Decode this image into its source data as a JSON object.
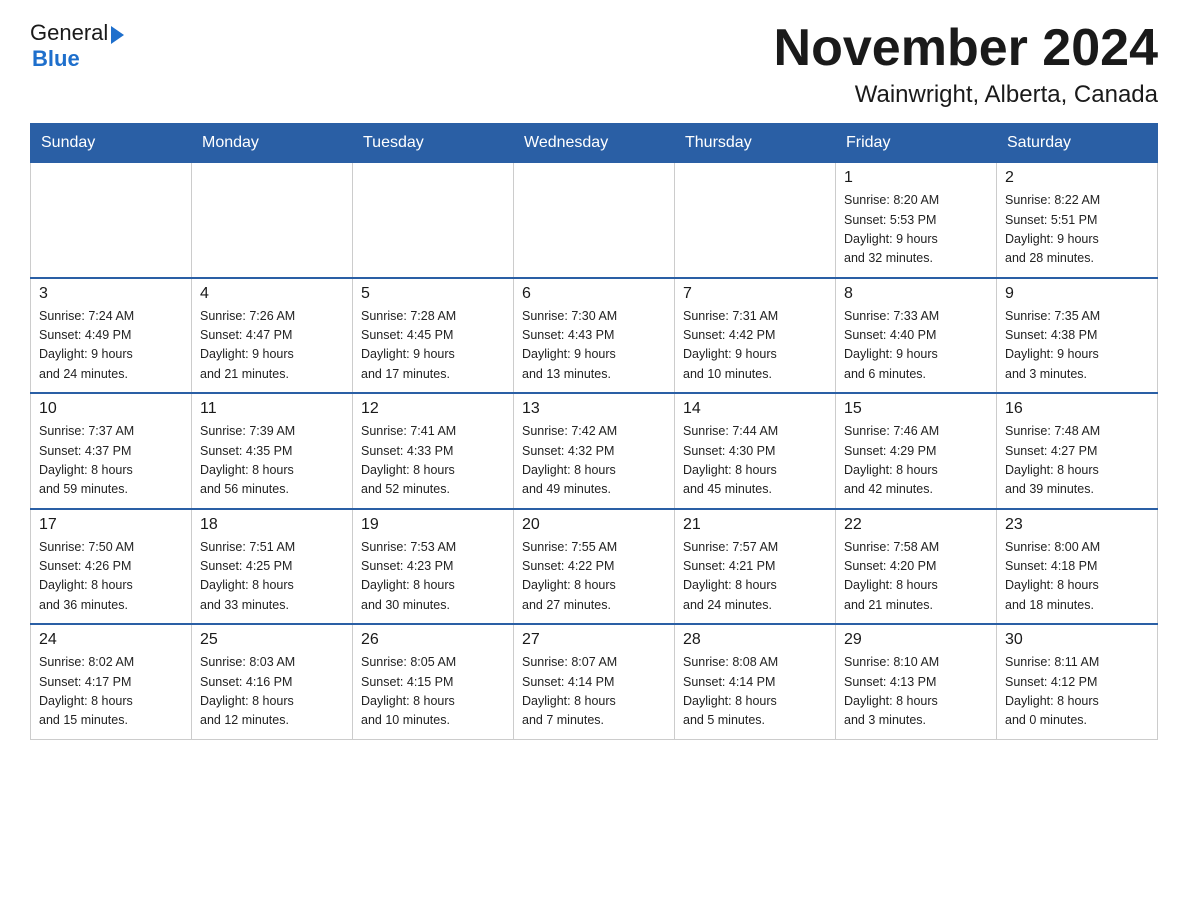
{
  "header": {
    "logo_general": "General",
    "logo_blue": "Blue",
    "month_title": "November 2024",
    "subtitle": "Wainwright, Alberta, Canada"
  },
  "weekdays": [
    "Sunday",
    "Monday",
    "Tuesday",
    "Wednesday",
    "Thursday",
    "Friday",
    "Saturday"
  ],
  "weeks": [
    [
      {
        "day": "",
        "info": ""
      },
      {
        "day": "",
        "info": ""
      },
      {
        "day": "",
        "info": ""
      },
      {
        "day": "",
        "info": ""
      },
      {
        "day": "",
        "info": ""
      },
      {
        "day": "1",
        "info": "Sunrise: 8:20 AM\nSunset: 5:53 PM\nDaylight: 9 hours\nand 32 minutes."
      },
      {
        "day": "2",
        "info": "Sunrise: 8:22 AM\nSunset: 5:51 PM\nDaylight: 9 hours\nand 28 minutes."
      }
    ],
    [
      {
        "day": "3",
        "info": "Sunrise: 7:24 AM\nSunset: 4:49 PM\nDaylight: 9 hours\nand 24 minutes."
      },
      {
        "day": "4",
        "info": "Sunrise: 7:26 AM\nSunset: 4:47 PM\nDaylight: 9 hours\nand 21 minutes."
      },
      {
        "day": "5",
        "info": "Sunrise: 7:28 AM\nSunset: 4:45 PM\nDaylight: 9 hours\nand 17 minutes."
      },
      {
        "day": "6",
        "info": "Sunrise: 7:30 AM\nSunset: 4:43 PM\nDaylight: 9 hours\nand 13 minutes."
      },
      {
        "day": "7",
        "info": "Sunrise: 7:31 AM\nSunset: 4:42 PM\nDaylight: 9 hours\nand 10 minutes."
      },
      {
        "day": "8",
        "info": "Sunrise: 7:33 AM\nSunset: 4:40 PM\nDaylight: 9 hours\nand 6 minutes."
      },
      {
        "day": "9",
        "info": "Sunrise: 7:35 AM\nSunset: 4:38 PM\nDaylight: 9 hours\nand 3 minutes."
      }
    ],
    [
      {
        "day": "10",
        "info": "Sunrise: 7:37 AM\nSunset: 4:37 PM\nDaylight: 8 hours\nand 59 minutes."
      },
      {
        "day": "11",
        "info": "Sunrise: 7:39 AM\nSunset: 4:35 PM\nDaylight: 8 hours\nand 56 minutes."
      },
      {
        "day": "12",
        "info": "Sunrise: 7:41 AM\nSunset: 4:33 PM\nDaylight: 8 hours\nand 52 minutes."
      },
      {
        "day": "13",
        "info": "Sunrise: 7:42 AM\nSunset: 4:32 PM\nDaylight: 8 hours\nand 49 minutes."
      },
      {
        "day": "14",
        "info": "Sunrise: 7:44 AM\nSunset: 4:30 PM\nDaylight: 8 hours\nand 45 minutes."
      },
      {
        "day": "15",
        "info": "Sunrise: 7:46 AM\nSunset: 4:29 PM\nDaylight: 8 hours\nand 42 minutes."
      },
      {
        "day": "16",
        "info": "Sunrise: 7:48 AM\nSunset: 4:27 PM\nDaylight: 8 hours\nand 39 minutes."
      }
    ],
    [
      {
        "day": "17",
        "info": "Sunrise: 7:50 AM\nSunset: 4:26 PM\nDaylight: 8 hours\nand 36 minutes."
      },
      {
        "day": "18",
        "info": "Sunrise: 7:51 AM\nSunset: 4:25 PM\nDaylight: 8 hours\nand 33 minutes."
      },
      {
        "day": "19",
        "info": "Sunrise: 7:53 AM\nSunset: 4:23 PM\nDaylight: 8 hours\nand 30 minutes."
      },
      {
        "day": "20",
        "info": "Sunrise: 7:55 AM\nSunset: 4:22 PM\nDaylight: 8 hours\nand 27 minutes."
      },
      {
        "day": "21",
        "info": "Sunrise: 7:57 AM\nSunset: 4:21 PM\nDaylight: 8 hours\nand 24 minutes."
      },
      {
        "day": "22",
        "info": "Sunrise: 7:58 AM\nSunset: 4:20 PM\nDaylight: 8 hours\nand 21 minutes."
      },
      {
        "day": "23",
        "info": "Sunrise: 8:00 AM\nSunset: 4:18 PM\nDaylight: 8 hours\nand 18 minutes."
      }
    ],
    [
      {
        "day": "24",
        "info": "Sunrise: 8:02 AM\nSunset: 4:17 PM\nDaylight: 8 hours\nand 15 minutes."
      },
      {
        "day": "25",
        "info": "Sunrise: 8:03 AM\nSunset: 4:16 PM\nDaylight: 8 hours\nand 12 minutes."
      },
      {
        "day": "26",
        "info": "Sunrise: 8:05 AM\nSunset: 4:15 PM\nDaylight: 8 hours\nand 10 minutes."
      },
      {
        "day": "27",
        "info": "Sunrise: 8:07 AM\nSunset: 4:14 PM\nDaylight: 8 hours\nand 7 minutes."
      },
      {
        "day": "28",
        "info": "Sunrise: 8:08 AM\nSunset: 4:14 PM\nDaylight: 8 hours\nand 5 minutes."
      },
      {
        "day": "29",
        "info": "Sunrise: 8:10 AM\nSunset: 4:13 PM\nDaylight: 8 hours\nand 3 minutes."
      },
      {
        "day": "30",
        "info": "Sunrise: 8:11 AM\nSunset: 4:12 PM\nDaylight: 8 hours\nand 0 minutes."
      }
    ]
  ]
}
